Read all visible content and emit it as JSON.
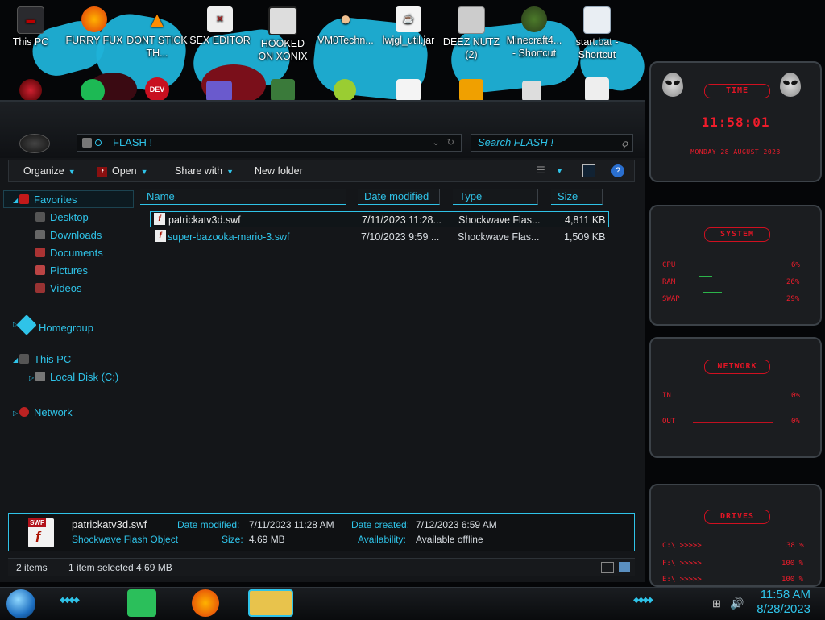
{
  "desktop": {
    "icons_top": [
      {
        "label": "This PC"
      },
      {
        "label": "FURRY FUX"
      },
      {
        "label": "DONT STICK TH..."
      },
      {
        "label": "SEX EDITOR"
      },
      {
        "label": "HOOKED ON XONIX"
      },
      {
        "label": "VM0Techn..."
      },
      {
        "label": "lwjgl_util.jar"
      },
      {
        "label": "DEEZ NUTZ (2)"
      },
      {
        "label": "Minecraft4... - Shortcut"
      },
      {
        "label": "start.bat - Shortcut"
      }
    ],
    "second_row_icon_text": "DEV C++"
  },
  "explorer": {
    "address": "FLASH !",
    "search_placeholder": "Search FLASH !",
    "toolbar": {
      "organize": "Organize",
      "open": "Open",
      "share_with": "Share with",
      "new_folder": "New folder"
    },
    "nav": {
      "favorites": "Favorites",
      "desktop": "Desktop",
      "downloads": "Downloads",
      "documents": "Documents",
      "pictures": "Pictures",
      "videos": "Videos",
      "homegroup": "Homegroup",
      "this_pc": "This PC",
      "local_disk": "Local Disk (C:)",
      "network": "Network"
    },
    "columns": {
      "name": "Name",
      "date_modified": "Date modified",
      "type": "Type",
      "size": "Size"
    },
    "files": [
      {
        "name": "patrickatv3d.swf",
        "date": "7/11/2023 11:28...",
        "type": "Shockwave Flas...",
        "size": "4,811 KB"
      },
      {
        "name": "super-bazooka-mario-3.swf",
        "date": "7/10/2023 9:59 ...",
        "type": "Shockwave Flas...",
        "size": "1,509 KB"
      }
    ],
    "details": {
      "filename": "patrickatv3d.swf",
      "filetype": "Shockwave Flash Object",
      "date_modified_label": "Date modified:",
      "date_modified": "7/11/2023 11:28 AM",
      "size_label": "Size:",
      "size": "4.69 MB",
      "date_created_label": "Date created:",
      "date_created": "7/12/2023 6:59 AM",
      "availability_label": "Availability:",
      "availability": "Available offline",
      "swf_tag": "SWF"
    },
    "status": {
      "items": "2 items",
      "selected": "1 item selected  4.69 MB"
    }
  },
  "gadgets": {
    "time": {
      "title": "TIME",
      "clock": "11:58:01",
      "date": "MONDAY 28 AUGUST 2023"
    },
    "system": {
      "title": "SYSTEM",
      "cpu_label": "CPU",
      "cpu": "6%",
      "ram_label": "RAM",
      "ram": "26%",
      "swap_label": "SWAP",
      "swap": "29%"
    },
    "network": {
      "title": "NETWORK",
      "in_label": "IN",
      "in": "0%",
      "out_label": "OUT",
      "out": "0%"
    },
    "drives": {
      "title": "DRIVES",
      "rows": [
        {
          "label": "C:\\ >>>>>",
          "value": "38 %"
        },
        {
          "label": "F:\\ >>>>>",
          "value": "100 %"
        },
        {
          "label": "E:\\ >>>>>",
          "value": "100 %"
        }
      ]
    }
  },
  "taskbar": {
    "time": "11:58 AM",
    "date": "8/28/2023"
  },
  "colors": {
    "accent": "#2fc3e8",
    "gadget_red": "#ef1c2b"
  }
}
